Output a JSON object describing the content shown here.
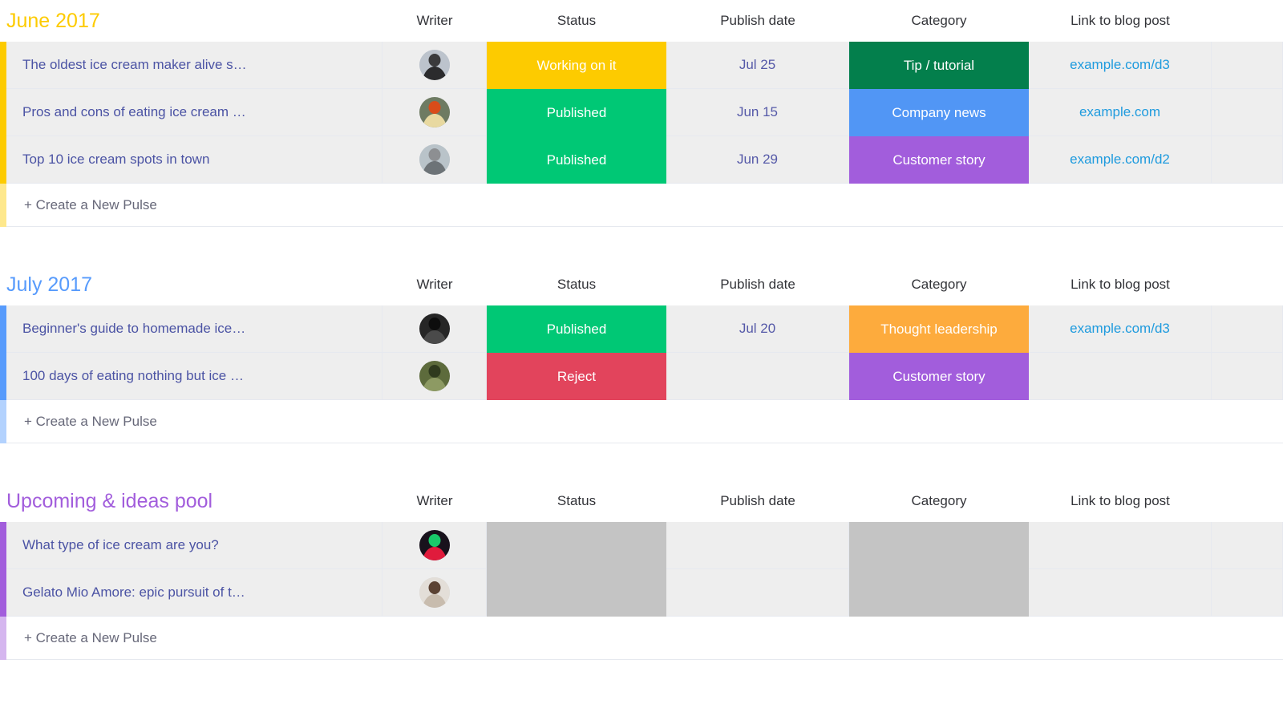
{
  "columns": {
    "title": "",
    "writer": "Writer",
    "status": "Status",
    "publish_date": "Publish date",
    "category": "Category",
    "link": "Link to blog post"
  },
  "add_row_label": "+ Create a New Pulse",
  "palette": {
    "yellow": "#fdcb00",
    "green": "#00c875",
    "red": "#e2445c",
    "dark_green": "#037f4c",
    "blue": "#5196f5",
    "purple": "#a25ddc",
    "orange": "#fdab3d",
    "empty_gray": "#c4c4c4",
    "cell_gray": "#eeeeee",
    "title_text": "#4b53a4",
    "date_text": "#5559a8",
    "link_text": "#1f9bde"
  },
  "groups": [
    {
      "title": "June 2017",
      "title_color": "#fdcb00",
      "bar_color": "#fdcb00",
      "rows": [
        {
          "title": "The oldest ice cream maker alive s…",
          "avatar": "avatar-person-hooded",
          "status": {
            "label": "Working on it",
            "color": "#fdcb00"
          },
          "date": "Jul 25",
          "category": {
            "label": "Tip / tutorial",
            "color": "#037f4c"
          },
          "link": "example.com/d3"
        },
        {
          "title": "Pros and cons of eating ice cream …",
          "avatar": "avatar-person-rooster",
          "status": {
            "label": "Published",
            "color": "#00c875"
          },
          "date": "Jun 15",
          "category": {
            "label": "Company news",
            "color": "#5196f5"
          },
          "link": "example.com"
        },
        {
          "title": "Top 10 ice cream spots in town",
          "avatar": "avatar-person-water",
          "status": {
            "label": "Published",
            "color": "#00c875"
          },
          "date": "Jun 29",
          "category": {
            "label": "Customer story",
            "color": "#a25ddc"
          },
          "link": "example.com/d2"
        }
      ]
    },
    {
      "title": "July 2017",
      "title_color": "#579bfc",
      "bar_color": "#579bfc",
      "rows": [
        {
          "title": "Beginner's guide to homemade ice…",
          "avatar": "avatar-person-dark",
          "status": {
            "label": "Published",
            "color": "#00c875"
          },
          "date": "Jul 20",
          "category": {
            "label": "Thought leadership",
            "color": "#fdab3d"
          },
          "link": "example.com/d3"
        },
        {
          "title": "100 days of eating nothing but ice …",
          "avatar": "avatar-person-forest",
          "status": {
            "label": "Reject",
            "color": "#e2445c"
          },
          "date": "",
          "category": {
            "label": "Customer story",
            "color": "#a25ddc"
          },
          "link": ""
        }
      ]
    },
    {
      "title": "Upcoming & ideas pool",
      "title_color": "#a25ddc",
      "bar_color": "#a25ddc",
      "rows": [
        {
          "title": "What type of ice cream are you?",
          "avatar": "avatar-person-neon",
          "status": {
            "label": "",
            "color": "#c4c4c4"
          },
          "date": "",
          "category": {
            "label": "",
            "color": "#c4c4c4"
          },
          "link": ""
        },
        {
          "title": "Gelato Mio Amore: epic pursuit of t…",
          "avatar": "avatar-person-braid",
          "status": {
            "label": "",
            "color": "#c4c4c4"
          },
          "date": "",
          "category": {
            "label": "",
            "color": "#c4c4c4"
          },
          "link": ""
        }
      ]
    }
  ]
}
